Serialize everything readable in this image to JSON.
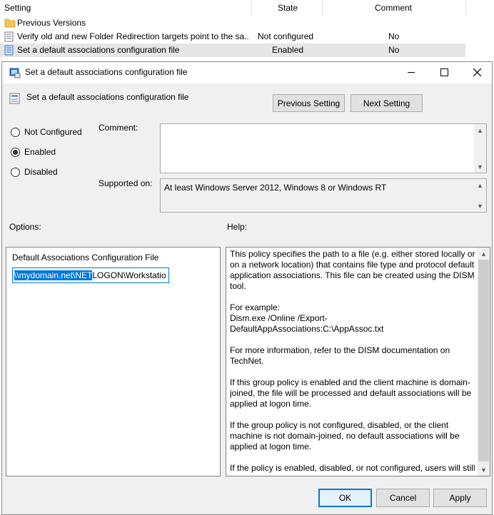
{
  "list": {
    "headers": {
      "setting": "Setting",
      "state": "State",
      "comment": "Comment"
    },
    "rows": [
      {
        "name": "Previous Versions",
        "state": "",
        "comment": "",
        "icon": "folder-icon"
      },
      {
        "name": "Verify old and new Folder Redirection targets point to the sa...",
        "state": "Not configured",
        "comment": "No",
        "icon": "policy-setting-icon"
      },
      {
        "name": "Set a default associations configuration file",
        "state": "Enabled",
        "comment": "No",
        "icon": "policy-setting-icon"
      }
    ]
  },
  "dialog": {
    "window_title": "Set a default associations configuration file",
    "setting_title": "Set a default associations configuration file",
    "prev_button": "Previous Setting",
    "next_button": "Next Setting",
    "radios": {
      "not_configured": "Not Configured",
      "enabled": "Enabled",
      "disabled": "Disabled",
      "selected": "enabled"
    },
    "comment_label": "Comment:",
    "comment_value": "",
    "supported_label": "Supported on:",
    "supported_value": "At least Windows Server 2012, Windows 8 or Windows RT",
    "options_label": "Options:",
    "help_label": "Help:",
    "option_field_label": "Default Associations Configuration File",
    "option_value_selected": "\\\\mydomain.net\\NET",
    "option_value_rest": "LOGON\\Workstatio",
    "help_paragraphs": [
      "This policy specifies the path to a file (e.g. either stored locally or on a network location) that contains file type and protocol default application associations. This file can be created using the DISM tool.",
      "For example:",
      "Dism.exe /Online /Export-DefaultAppAssociations:C:\\AppAssoc.txt",
      "For more information, refer to the DISM documentation on TechNet.",
      "If this group policy is enabled and the client machine is domain-joined, the file will be processed and default associations will be applied at logon time.",
      "If the group policy is not configured, disabled, or the client machine is not domain-joined, no default associations will be applied at logon time.",
      "If the policy is enabled, disabled, or not configured, users will still"
    ],
    "ok_button": "OK",
    "cancel_button": "Cancel",
    "apply_button": "Apply"
  }
}
